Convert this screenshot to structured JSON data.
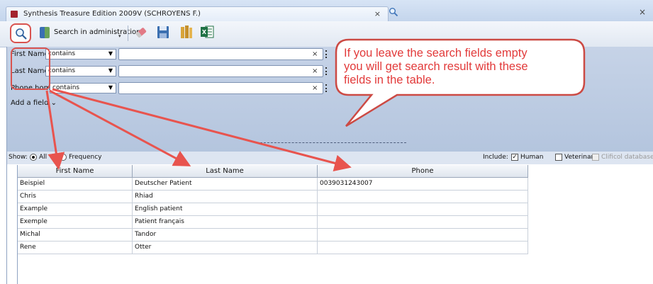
{
  "window": {
    "title": "Synthesis Treasure Edition 2009V (SCHROYENS F.)",
    "close_glyph": "×",
    "tab_close_glyph": "×"
  },
  "toolbar": {
    "search_icon": "search-icon",
    "admin_label": "Search in administration",
    "admin_caret": "▾",
    "icons": [
      "eraser-icon",
      "save-icon",
      "books-icon",
      "excel-icon"
    ]
  },
  "search": {
    "fields": [
      {
        "label": "First Name",
        "operator": "contains",
        "value": "",
        "clear": "×"
      },
      {
        "label": "Last Name",
        "operator": "contains",
        "value": "",
        "clear": "×"
      },
      {
        "label": "Phone home",
        "operator": "contains",
        "value": "",
        "clear": "×"
      }
    ],
    "add_field": "Add a field ⌄"
  },
  "options": {
    "show_label": "Show:",
    "show_all": "All",
    "show_frequency": "Frequency",
    "show_selected": "All",
    "include_label": "Include:",
    "include": [
      {
        "label": "Human",
        "checked": true,
        "enabled": true
      },
      {
        "label": "Veterinary",
        "checked": false,
        "enabled": true
      },
      {
        "label": "Clificol database",
        "checked": false,
        "enabled": false
      }
    ]
  },
  "table": {
    "columns": [
      "First Name",
      "Last Name",
      "Phone"
    ],
    "rows": [
      [
        "Beispiel",
        "Deutscher Patient",
        "0039031243007"
      ],
      [
        "Chris",
        "Rhiad",
        ""
      ],
      [
        "Example",
        "English patient",
        ""
      ],
      [
        "Exemple",
        "Patient français",
        ""
      ],
      [
        "Michal",
        "Tandor",
        ""
      ],
      [
        "Rene",
        "Otter",
        ""
      ]
    ]
  },
  "callout": {
    "lines": [
      "If you leave the search fields empty",
      "you will get search result with these",
      "fields in the  table."
    ],
    "color": "#e23a3a"
  },
  "colors": {
    "annotation": "#d9534f",
    "panel": "#b4c5de",
    "titlebar": "#c4d5ec"
  }
}
